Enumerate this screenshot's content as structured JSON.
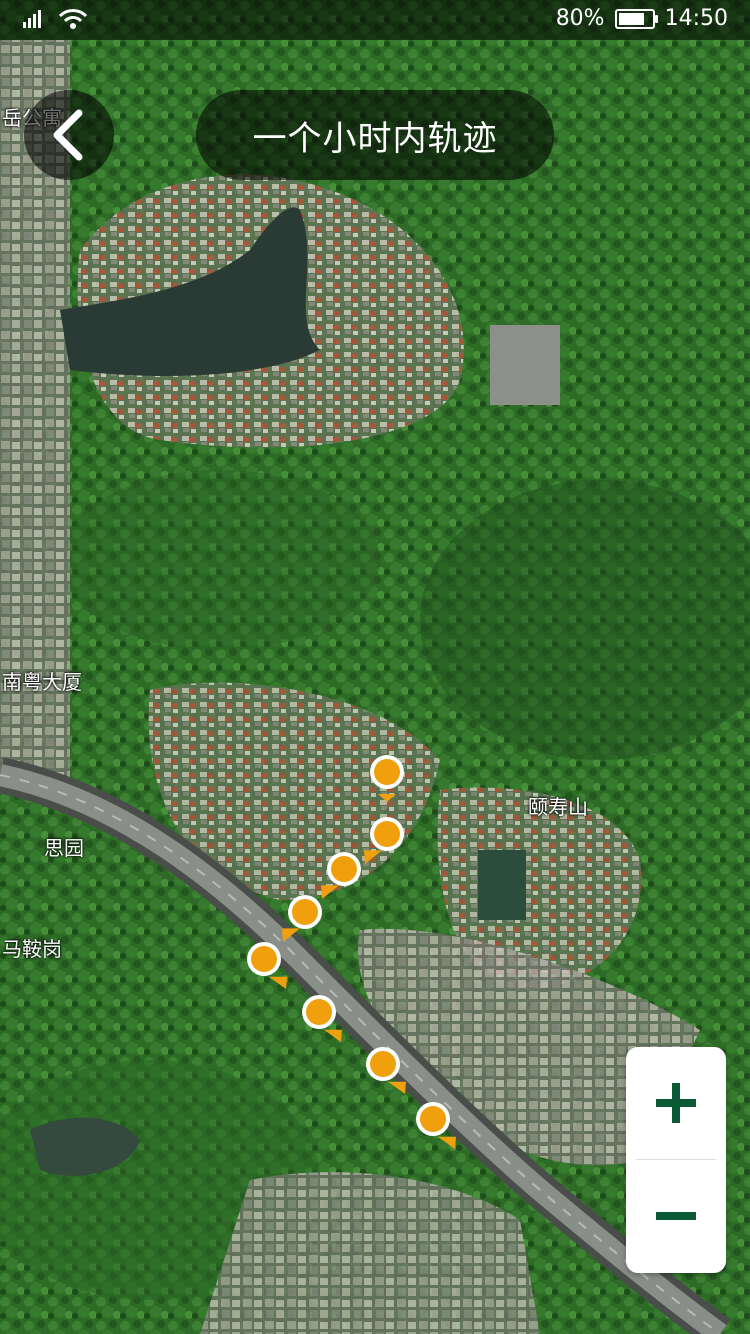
{
  "status_bar": {
    "battery_text": "80%",
    "battery_level": 0.8,
    "time": "14:50"
  },
  "header": {
    "back_icon": "chevron-left-icon",
    "title": "一个小时内轨迹"
  },
  "map": {
    "type": "satellite",
    "labels": {
      "top_left": "岳公寓",
      "left_mid": "南粤大厦",
      "siyuan": "思园",
      "majiagang": "马鞍岗",
      "yishoushan": "颐寿山"
    },
    "track_point_count": 8,
    "track_color": "#f0a00c"
  },
  "zoom": {
    "zoom_in_icon": "plus-icon",
    "zoom_out_icon": "minus-icon",
    "color": "#0a5a35"
  }
}
